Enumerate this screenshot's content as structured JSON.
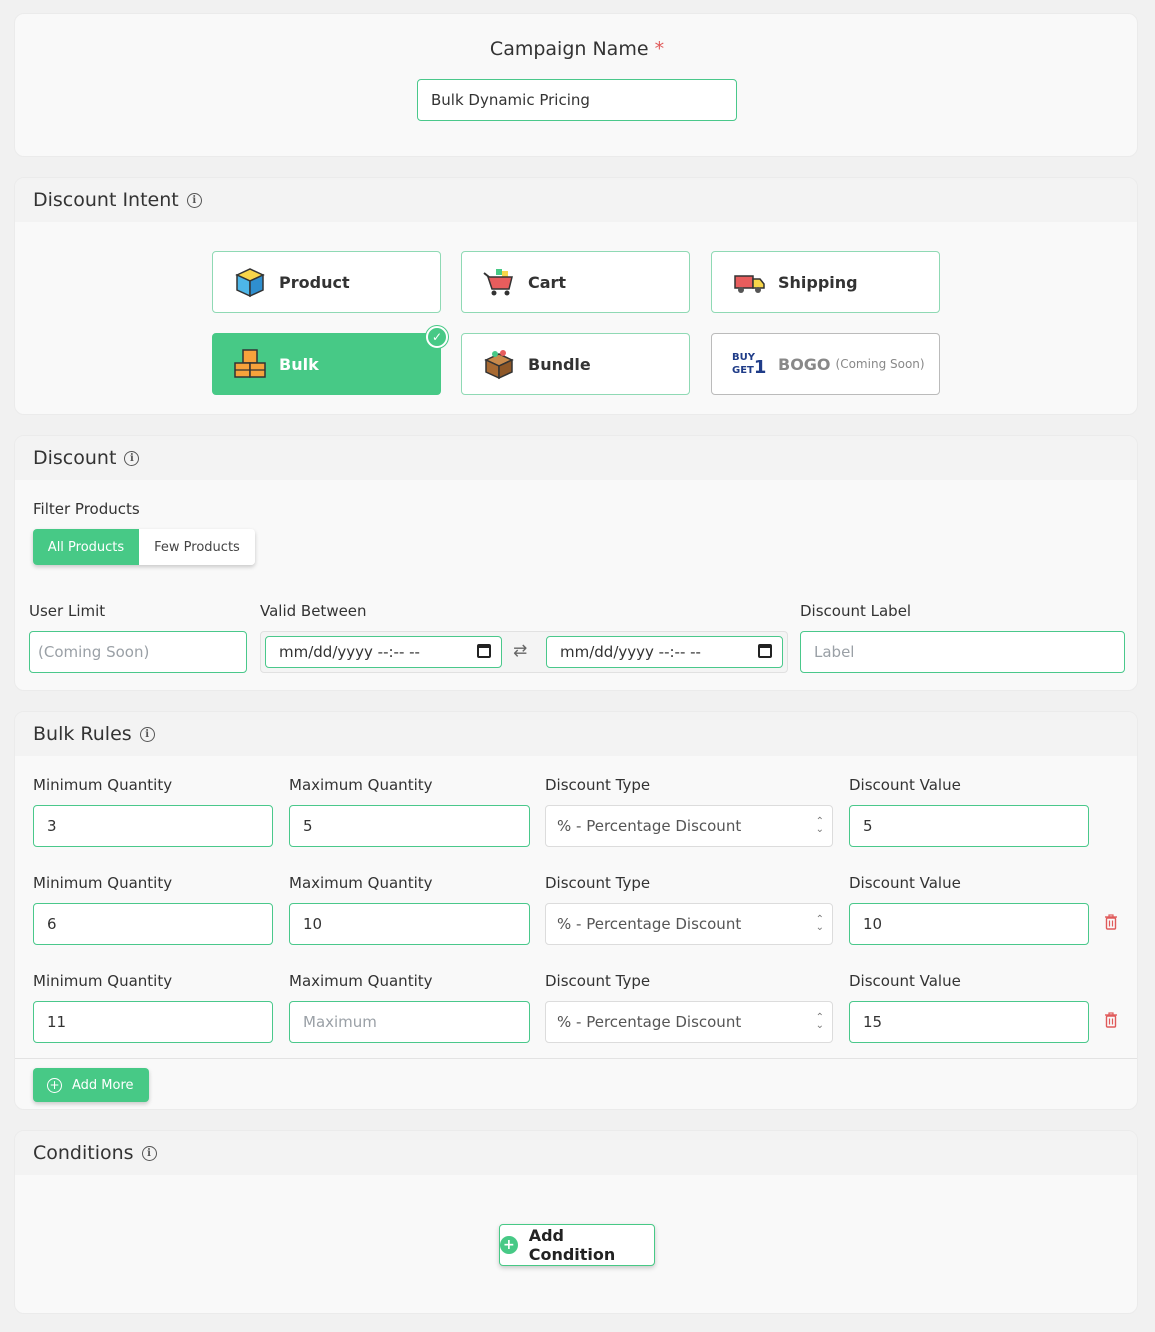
{
  "campaign": {
    "label": "Campaign Name",
    "required_mark": "*",
    "value": "Bulk Dynamic Pricing"
  },
  "intent": {
    "title": "Discount Intent",
    "tiles": [
      {
        "label": "Product",
        "icon": "product-box-icon"
      },
      {
        "label": "Cart",
        "icon": "cart-icon"
      },
      {
        "label": "Shipping",
        "icon": "truck-icon"
      },
      {
        "label": "Bulk",
        "icon": "bulk-boxes-icon",
        "selected": true
      },
      {
        "label": "Bundle",
        "icon": "bundle-box-icon"
      },
      {
        "label": "BOGO",
        "sub": "(Coming Soon)",
        "icon": "buy-get-icon",
        "disabled": true
      }
    ]
  },
  "discount": {
    "title": "Discount",
    "filter_label": "Filter Products",
    "filter_options": [
      "All Products",
      "Few Products"
    ],
    "user_limit_label": "User Limit",
    "user_limit_placeholder": "(Coming Soon)",
    "valid_between_label": "Valid Between",
    "date_placeholder": "mm/dd/yyyy --:-- --",
    "label_field_label": "Discount Label",
    "label_placeholder": "Label"
  },
  "bulk": {
    "title": "Bulk Rules",
    "col_labels": {
      "min": "Minimum Quantity",
      "max": "Maximum Quantity",
      "type": "Discount Type",
      "value": "Discount Value"
    },
    "rows": [
      {
        "min": "3",
        "max": "5",
        "type": "% - Percentage Discount",
        "value": "5"
      },
      {
        "min": "6",
        "max": "10",
        "type": "% - Percentage Discount",
        "value": "10"
      },
      {
        "min": "11",
        "max": "",
        "max_placeholder": "Maximum",
        "type": "% - Percentage Discount",
        "value": "15"
      }
    ],
    "add_more_label": "Add More"
  },
  "conditions": {
    "title": "Conditions",
    "add_label": "Add Condition"
  },
  "colors": {
    "accent": "#47c986",
    "danger": "#e05a5a"
  }
}
